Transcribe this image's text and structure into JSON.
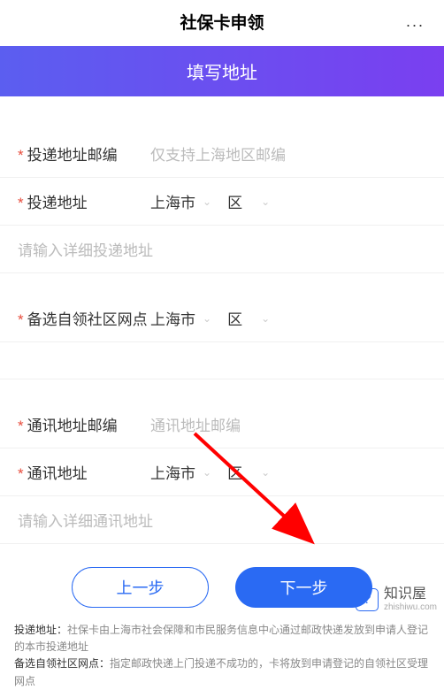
{
  "header": {
    "title": "社保卡申领",
    "more_icon": "..."
  },
  "banner": {
    "label": "填写地址"
  },
  "form": {
    "delivery_zip": {
      "label": "投递地址邮编",
      "placeholder": "仅支持上海地区邮编"
    },
    "delivery_addr": {
      "label": "投递地址",
      "city": "上海市",
      "district_placeholder": "区"
    },
    "delivery_detail": {
      "placeholder": "请输入详细投递地址"
    },
    "pickup_point": {
      "label": "备选自领社区网点",
      "city": "上海市",
      "district_placeholder": "区"
    },
    "contact_zip": {
      "label": "通讯地址邮编",
      "placeholder": "通讯地址邮编"
    },
    "contact_addr": {
      "label": "通讯地址",
      "city": "上海市",
      "district_placeholder": "区"
    },
    "contact_detail": {
      "placeholder": "请输入详细通讯地址"
    }
  },
  "buttons": {
    "prev": "上一步",
    "next": "下一步"
  },
  "footer": {
    "line1_label": "投递地址：",
    "line1_text": "社保卡由上海市社会保障和市民服务信息中心通过邮政快递发放到申请人登记的本市投递地址",
    "line2_label": "备选自领社区网点：",
    "line2_text": "指定邮政快递上门投递不成功的，卡将放到申请登记的自领社区受理网点"
  },
  "watermark": {
    "logo_char": "?",
    "name": "知识屋",
    "url": "zhishiwu.com"
  }
}
